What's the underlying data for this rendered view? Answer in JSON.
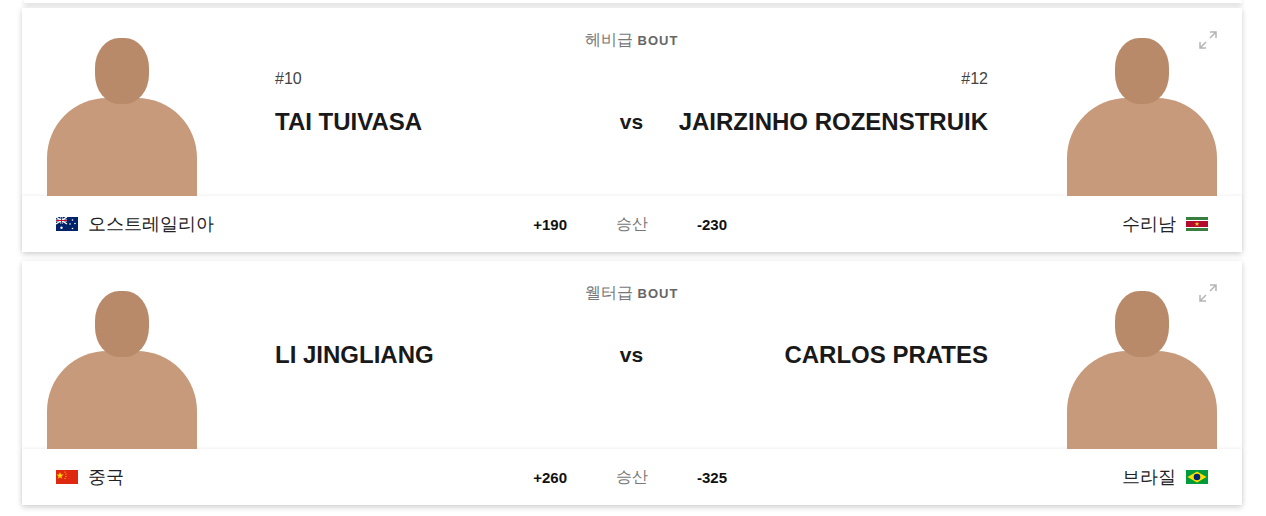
{
  "bouts": [
    {
      "weight_class": "헤비급",
      "bout_label": "BOUT",
      "vs": "vs",
      "odds_label": "승산",
      "red": {
        "rank": "#10",
        "name": "TAI TUIVASA",
        "country": "오스트레일리아",
        "odds": "+190",
        "kind": "australia"
      },
      "blue": {
        "rank": "#12",
        "name": "JAIRZINHO ROZENSTRUIK",
        "country": "수리남",
        "odds": "-230",
        "kind": "suriname"
      }
    },
    {
      "weight_class": "웰터급",
      "bout_label": "BOUT",
      "vs": "vs",
      "odds_label": "승산",
      "red": {
        "name": "LI JINGLIANG",
        "country": "중국",
        "odds": "+260",
        "kind": "china"
      },
      "blue": {
        "name": "CARLOS PRATES",
        "country": "브라질",
        "odds": "-325",
        "kind": "brazil"
      }
    }
  ]
}
